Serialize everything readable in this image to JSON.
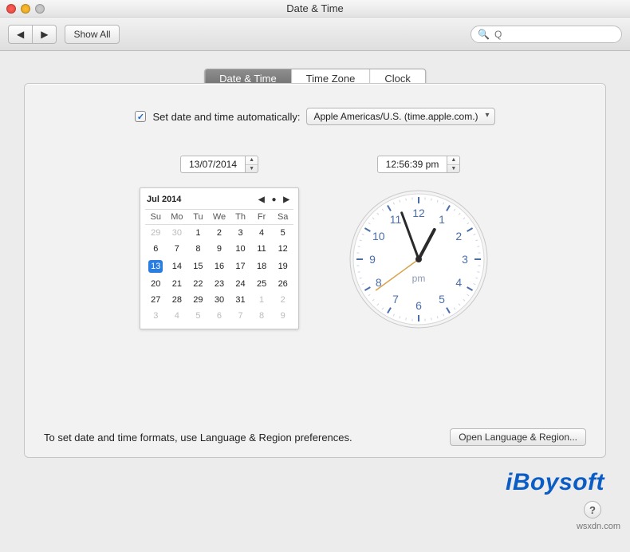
{
  "window": {
    "title": "Date & Time"
  },
  "toolbar": {
    "back": "◀",
    "fwd": "▶",
    "show_all": "Show All",
    "search_placeholder": "Q"
  },
  "tabs": [
    {
      "label": "Date & Time",
      "active": true
    },
    {
      "label": "Time Zone",
      "active": false
    },
    {
      "label": "Clock",
      "active": false
    }
  ],
  "auto": {
    "checked": true,
    "label": "Set date and time automatically:",
    "server": "Apple Americas/U.S. (time.apple.com.)"
  },
  "date": {
    "field": "13/07/2014",
    "month_label": "Jul 2014",
    "weekdays": [
      "Su",
      "Mo",
      "Tu",
      "We",
      "Th",
      "Fr",
      "Sa"
    ],
    "weeks": [
      [
        {
          "d": 29,
          "dim": true
        },
        {
          "d": 30,
          "dim": true
        },
        {
          "d": 1
        },
        {
          "d": 2
        },
        {
          "d": 3
        },
        {
          "d": 4
        },
        {
          "d": 5
        }
      ],
      [
        {
          "d": 6
        },
        {
          "d": 7
        },
        {
          "d": 8
        },
        {
          "d": 9
        },
        {
          "d": 10
        },
        {
          "d": 11
        },
        {
          "d": 12
        }
      ],
      [
        {
          "d": 13,
          "sel": true
        },
        {
          "d": 14
        },
        {
          "d": 15
        },
        {
          "d": 16
        },
        {
          "d": 17
        },
        {
          "d": 18
        },
        {
          "d": 19
        }
      ],
      [
        {
          "d": 20
        },
        {
          "d": 21
        },
        {
          "d": 22
        },
        {
          "d": 23
        },
        {
          "d": 24
        },
        {
          "d": 25
        },
        {
          "d": 26
        }
      ],
      [
        {
          "d": 27
        },
        {
          "d": 28
        },
        {
          "d": 29
        },
        {
          "d": 30
        },
        {
          "d": 31
        },
        {
          "d": 1,
          "dim": true
        },
        {
          "d": 2,
          "dim": true
        }
      ],
      [
        {
          "d": 3,
          "dim": true
        },
        {
          "d": 4,
          "dim": true
        },
        {
          "d": 5,
          "dim": true
        },
        {
          "d": 6,
          "dim": true
        },
        {
          "d": 7,
          "dim": true
        },
        {
          "d": 8,
          "dim": true
        },
        {
          "d": 9,
          "dim": true
        }
      ]
    ]
  },
  "time": {
    "field": "12:56:39 pm",
    "ampm": "pm",
    "hour": 12,
    "minute": 56,
    "second": 39,
    "numerals": [
      "12",
      "1",
      "2",
      "3",
      "4",
      "5",
      "6",
      "7",
      "8",
      "9",
      "10",
      "11"
    ]
  },
  "footer": {
    "hint": "To set date and time formats, use Language & Region preferences.",
    "open_btn": "Open Language & Region..."
  },
  "watermark": "iBoysoft",
  "source": "wsxdn.com",
  "help": "?"
}
